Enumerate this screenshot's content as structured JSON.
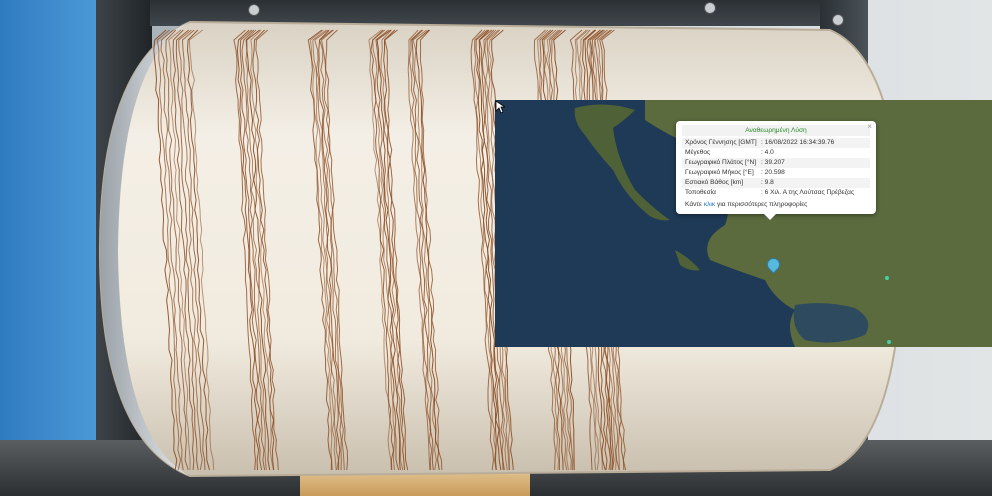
{
  "popup": {
    "title": "Αναθεωρημένη Λύση",
    "close_label": "×",
    "rows": [
      {
        "label": "Χρόνος Γέννησης [GMT]",
        "value": ": 16/08/2022 16:34:39.76"
      },
      {
        "label": "Μέγεθος",
        "value": ": 4.0"
      },
      {
        "label": "Γεωγραφικό Πλάτος [°N]",
        "value": ": 39.207"
      },
      {
        "label": "Γεωγραφικό Μήκος [°E]",
        "value": ": 20.598"
      },
      {
        "label": "Εστιακό Βάθος [km]",
        "value": ": 9.8"
      },
      {
        "label": "Τοποθεσία",
        "value": ": 6 Χιλ. Α της Λούτσας Πρέβεζας"
      }
    ],
    "footer_prefix": "Κάντε",
    "footer_link": "κλικ",
    "footer_suffix": "για περισσότερες πληροφορίες"
  },
  "colors": {
    "title_green": "#2a8a2a",
    "link_blue": "#1c6fc0",
    "marker_blue": "#58b9df",
    "trace_brown": "#8a4a1f"
  },
  "icons": [
    "close-icon",
    "map-pin-icon",
    "cursor-icon"
  ]
}
